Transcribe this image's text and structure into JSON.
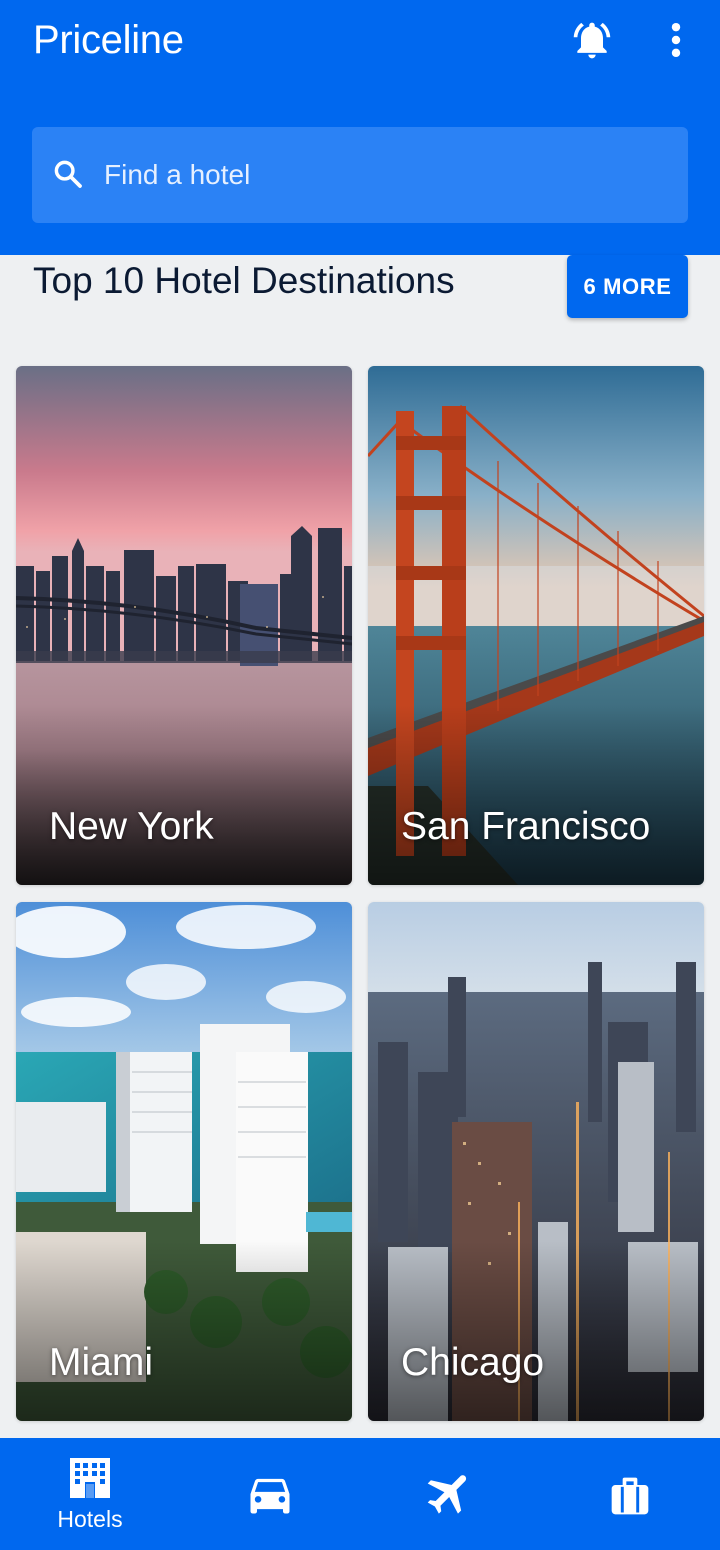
{
  "header": {
    "app_title": "Priceline",
    "bell_icon": "notification-bell-icon",
    "menu_icon": "more-vert-icon"
  },
  "search": {
    "placeholder": "Find a hotel",
    "icon": "search-icon"
  },
  "section": {
    "title": "Top 10 Hotel Destinations",
    "more_label": "6 MORE"
  },
  "destinations": [
    {
      "city": "New York"
    },
    {
      "city": "San Francisco"
    },
    {
      "city": "Miami"
    },
    {
      "city": "Chicago"
    }
  ],
  "bottom_nav": {
    "items": [
      {
        "label": "Hotels",
        "icon": "hotel-building-icon",
        "active": true
      },
      {
        "label": "",
        "icon": "car-icon"
      },
      {
        "label": "",
        "icon": "airplane-icon"
      },
      {
        "label": "",
        "icon": "suitcase-icon"
      }
    ]
  },
  "colors": {
    "brand_blue": "#0068ef",
    "search_field": "#2b82f5",
    "background": "#eef0f2",
    "title_text": "#0b1a33"
  }
}
